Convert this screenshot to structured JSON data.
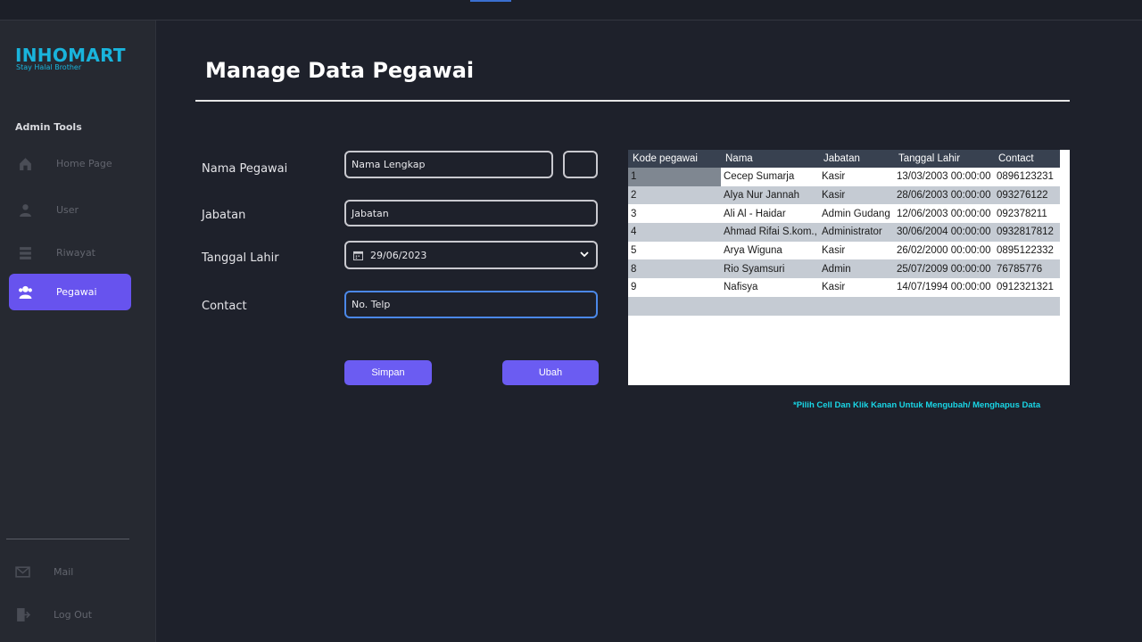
{
  "app": {
    "logo": "INHOMART",
    "tagline": "Stay Halal Brother",
    "section_label": "Admin Tools"
  },
  "sidebar": {
    "items": [
      {
        "label": "Home Page",
        "icon": "home-icon",
        "active": false
      },
      {
        "label": "User",
        "icon": "user-icon",
        "active": false
      },
      {
        "label": "Riwayat",
        "icon": "history-icon",
        "active": false
      },
      {
        "label": "Pegawai",
        "icon": "employees-icon",
        "active": true
      }
    ],
    "bottom_items": [
      {
        "label": "Mail",
        "icon": "mail-icon"
      },
      {
        "label": "Log Out",
        "icon": "logout-icon"
      }
    ]
  },
  "page": {
    "title": "Manage Data Pegawai"
  },
  "form": {
    "nama_label": "Nama Pegawai",
    "nama_value": "Nama Lengkap",
    "jabatan_label": "Jabatan",
    "jabatan_value": "Jabatan",
    "tanggal_label": "Tanggal Lahir",
    "tanggal_value": "29/06/2023",
    "contact_label": "Contact",
    "contact_value": "No. Telp",
    "save_label": "Simpan",
    "update_label": "Ubah"
  },
  "table": {
    "columns": [
      "Kode pegawai",
      "Nama",
      "Jabatan",
      "Tanggal Lahir",
      "Contact"
    ],
    "rows": [
      [
        "1",
        "Cecep Sumarja",
        "Kasir",
        "13/03/2003 00:00:00",
        "0896123231"
      ],
      [
        "2",
        "Alya Nur Jannah",
        "Kasir",
        "28/06/2003 00:00:00",
        "093276122"
      ],
      [
        "3",
        "Ali Al - Haidar",
        "Admin Gudang",
        "12/06/2003 00:00:00",
        "092378211"
      ],
      [
        "4",
        "Ahmad Rifai S.kom.,",
        "Administrator",
        "30/06/2004 00:00:00",
        "0932817812"
      ],
      [
        "5",
        "Arya Wiguna",
        "Kasir",
        "26/02/2000 00:00:00",
        "0895122332"
      ],
      [
        "8",
        "Rio Syamsuri",
        "Admin",
        "25/07/2009 00:00:00",
        "76785776"
      ],
      [
        "9",
        "Nafisya",
        "Kasir",
        "14/07/1994 00:00:00",
        "0912321321"
      ]
    ]
  },
  "hint": "*Pilih Cell Dan Klik Kanan Untuk Mengubah/ Menghapus Data",
  "colors": {
    "accent": "#6753ee",
    "brand": "#19b4dc",
    "background": "#1e212b"
  }
}
